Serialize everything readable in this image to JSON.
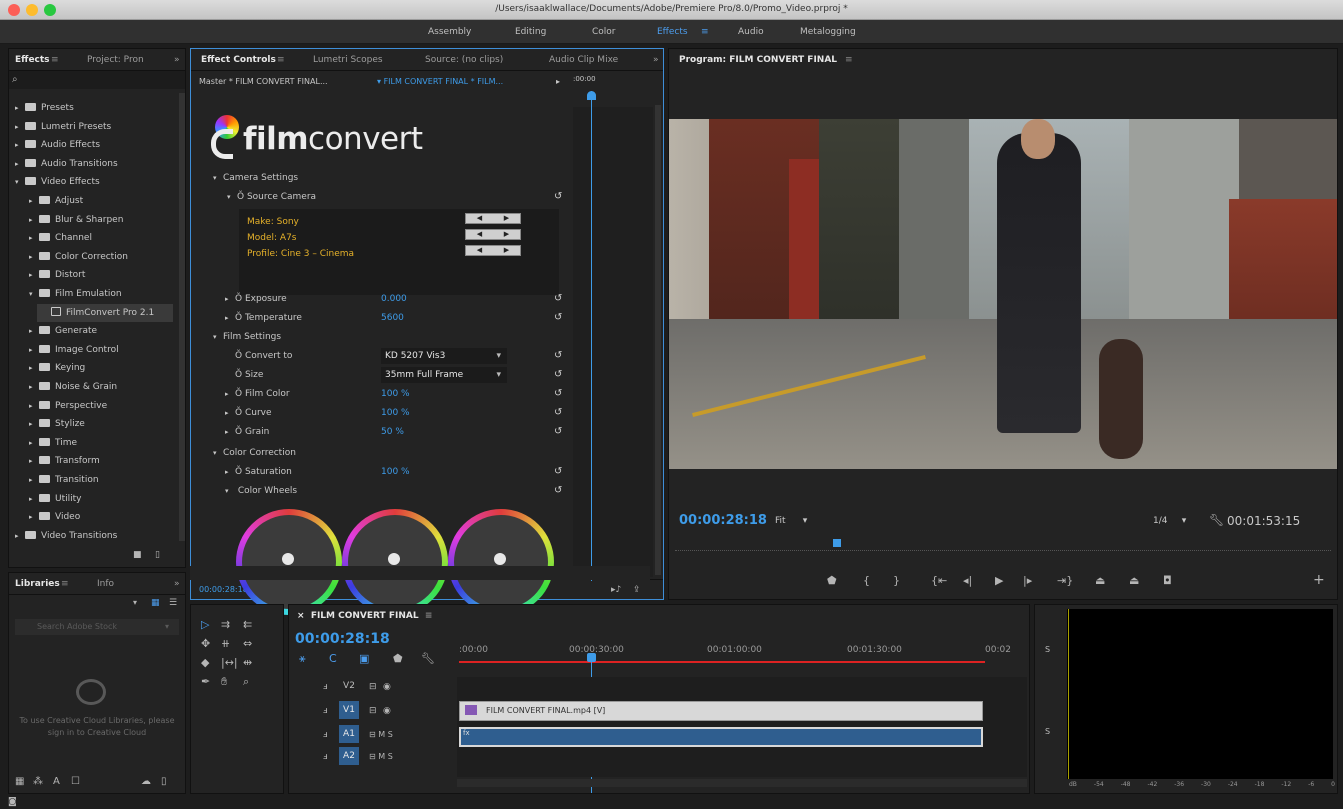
{
  "window": {
    "title": "/Users/isaaklwallace/Documents/Adobe/Premiere Pro/8.0/Promo_Video.prproj *"
  },
  "workspaces": [
    "Assembly",
    "Editing",
    "Color",
    "Effects",
    "Audio",
    "Metalogging"
  ],
  "workspace_active": "Effects",
  "effects_panel": {
    "tabs": [
      "Effects",
      "Project: Pron"
    ],
    "tree": [
      {
        "label": "Presets",
        "level": 0,
        "type": "preset"
      },
      {
        "label": "Lumetri Presets",
        "level": 0,
        "type": "preset"
      },
      {
        "label": "Audio Effects",
        "level": 0,
        "type": "folder"
      },
      {
        "label": "Audio Transitions",
        "level": 0,
        "type": "folder"
      },
      {
        "label": "Video Effects",
        "level": 0,
        "type": "folder",
        "open": true
      },
      {
        "label": "Adjust",
        "level": 1,
        "type": "folder"
      },
      {
        "label": "Blur & Sharpen",
        "level": 1,
        "type": "folder"
      },
      {
        "label": "Channel",
        "level": 1,
        "type": "folder"
      },
      {
        "label": "Color Correction",
        "level": 1,
        "type": "folder"
      },
      {
        "label": "Distort",
        "level": 1,
        "type": "folder"
      },
      {
        "label": "Film Emulation",
        "level": 1,
        "type": "folder",
        "open": true
      },
      {
        "label": "FilmConvert Pro 2.1",
        "level": 2,
        "type": "effect",
        "selected": true
      },
      {
        "label": "Generate",
        "level": 1,
        "type": "folder"
      },
      {
        "label": "Image Control",
        "level": 1,
        "type": "folder"
      },
      {
        "label": "Keying",
        "level": 1,
        "type": "folder"
      },
      {
        "label": "Noise & Grain",
        "level": 1,
        "type": "folder"
      },
      {
        "label": "Perspective",
        "level": 1,
        "type": "folder"
      },
      {
        "label": "Stylize",
        "level": 1,
        "type": "folder"
      },
      {
        "label": "Time",
        "level": 1,
        "type": "folder"
      },
      {
        "label": "Transform",
        "level": 1,
        "type": "folder"
      },
      {
        "label": "Transition",
        "level": 1,
        "type": "folder"
      },
      {
        "label": "Utility",
        "level": 1,
        "type": "folder"
      },
      {
        "label": "Video",
        "level": 1,
        "type": "folder"
      },
      {
        "label": "Video Transitions",
        "level": 0,
        "type": "folder"
      }
    ]
  },
  "libraries_panel": {
    "tabs": [
      "Libraries",
      "Info"
    ],
    "search_placeholder": "Search Adobe Stock",
    "message": "To use Creative Cloud Libraries, please sign in to Creative Cloud"
  },
  "effect_controls": {
    "tabs": [
      "Effect Controls",
      "Lumetri Scopes",
      "Source: (no clips)",
      "Audio Clip Mixe"
    ],
    "master_label": "Master * FILM CONVERT FINAL...",
    "clip_label": "FILM CONVERT FINAL * FILM...",
    "ruler_time": ":00:00",
    "logo_bold": "film",
    "logo_light": "convert",
    "camera_settings": "Camera Settings",
    "source_camera": "Source Camera",
    "make": "Make: Sony",
    "model": "Model: A7s",
    "profile": "Profile: Cine 3 – Cinema",
    "exposure_label": "Exposure",
    "exposure_value": "0.000",
    "temperature_label": "Temperature",
    "temperature_value": "5600",
    "film_settings": "Film Settings",
    "convert_to_label": "Convert to",
    "convert_to_value": "KD 5207 Vis3",
    "size_label": "Size",
    "size_value": "35mm Full Frame",
    "film_color_label": "Film Color",
    "film_color_value": "100 %",
    "curve_label": "Curve",
    "curve_value": "100 %",
    "grain_label": "Grain",
    "grain_value": "50 %",
    "color_correction": "Color Correction",
    "saturation_label": "Saturation",
    "saturation_value": "100 %",
    "color_wheels": "Color Wheels",
    "timecode": "00:00:28:18"
  },
  "program_monitor": {
    "title": "Program: FILM CONVERT FINAL",
    "timecode": "00:00:28:18",
    "fit": "Fit",
    "resolution": "1/4",
    "duration": "00:01:53:15"
  },
  "timeline": {
    "title": "FILM CONVERT FINAL",
    "timecode": "00:00:28:18",
    "ruler": [
      ":00:00",
      "00:00:30:00",
      "00:01:00:00",
      "00:01:30:00",
      "00:02"
    ],
    "tracks": [
      "V2",
      "V1",
      "A1",
      "A2"
    ],
    "video_clip": "FILM CONVERT FINAL.mp4 [V]",
    "audio_clip_marker": "fx"
  },
  "audio_meter": {
    "labels": [
      "S",
      "S"
    ],
    "scale": [
      "dB",
      "-54",
      "-48",
      "-42",
      "-36",
      "-30",
      "-24",
      "-18",
      "-12",
      "-6",
      "0"
    ]
  }
}
